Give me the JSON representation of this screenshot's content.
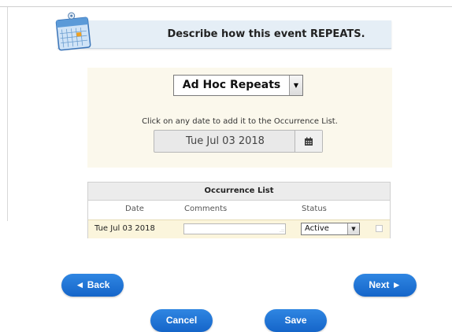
{
  "header": {
    "title": "Describe how this event REPEATS."
  },
  "repeat": {
    "selected": "Ad Hoc Repeats"
  },
  "instruction": "Click on any date to add it to the Occurrence List.",
  "date_picker": {
    "value": "Tue Jul 03 2018"
  },
  "occurrence_list": {
    "title": "Occurrence List",
    "columns": [
      "Date",
      "Comments",
      "Status"
    ],
    "rows": [
      {
        "date": "Tue Jul 03 2018",
        "comment": "",
        "status": "Active",
        "checked": false
      }
    ]
  },
  "buttons": {
    "back": "◄ Back",
    "next": "Next ►",
    "cancel": "Cancel",
    "save": "Save"
  },
  "colors": {
    "accent": "#1f74d6",
    "panel_bg": "#fbf8ec",
    "banner_bg": "#e5eef6",
    "row_bg": "#fbf5dc"
  },
  "icons": {
    "header": "calendar-icon",
    "date_picker": "calendar-icon"
  }
}
